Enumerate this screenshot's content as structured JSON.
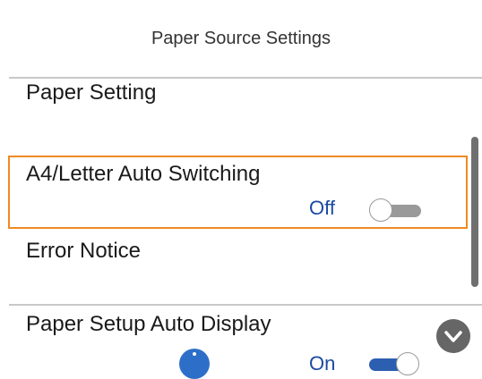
{
  "header": {
    "title": "Paper Source Settings"
  },
  "settings": {
    "paper_setting": {
      "label": "Paper Setting"
    },
    "auto_switching": {
      "label": "A4/Letter Auto Switching",
      "state": "Off",
      "enabled": false
    },
    "error_notice": {
      "label": "Error Notice"
    },
    "setup_auto_display": {
      "label": "Paper Setup Auto Display",
      "state": "On",
      "enabled": true
    }
  },
  "icons": {
    "info": "info-icon",
    "scroll_down": "chevron-down-icon"
  },
  "colors": {
    "highlight_border": "#ee8a24",
    "state_text": "#1b4aa1",
    "toggle_off_track": "#9a9a9a",
    "toggle_on_track": "#2d5fb0",
    "info_icon": "#2d6fc8"
  }
}
